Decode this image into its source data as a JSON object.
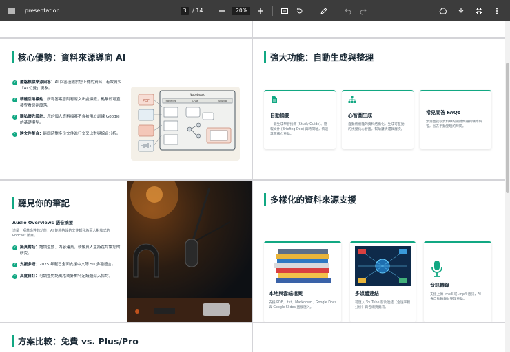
{
  "toolbar": {
    "title": "presentation",
    "page_current": "3",
    "page_total": "/ 14",
    "zoom": "20%"
  },
  "slides": {
    "s1": {
      "title": "核心優勢：資料來源導向 AI",
      "bullets": [
        {
          "label": "嚴格根據來源回答：",
          "text": "AI 回答僅限於您上傳的資料，有效減少「AI 幻覺」現象。"
        },
        {
          "label": "精確引用標註：",
          "text": "所有答案皆附有原文出處標籤，點擊即可直接查看原始段落。"
        },
        {
          "label": "隱私優先設計：",
          "text": "您的個人資料檔案不會被用於訓練 Google 的基礎模型。"
        },
        {
          "label": "跨文件整合：",
          "text": "能同時對多份文件進行交叉比對與綜合分析。"
        }
      ],
      "illustration": {
        "window_title": "Notebook",
        "tabs": [
          "Sources",
          "Chat",
          "Studio"
        ],
        "pdf_label": "PDF"
      }
    },
    "s2": {
      "title": "強大功能：自動生成與整理",
      "cards": [
        {
          "icon": "document-icon",
          "title": "自動摘要",
          "desc": "一鍵生成學習指南 (Study Guide)、簡報文件 (Briefing Doc) 與時間軸，快速掌握核心重點。"
        },
        {
          "icon": "sitemap-icon",
          "title": "心智圖生成",
          "desc": "自動將複雜的資料結構化，生成可互動的視覺化心智圖，幫助釐清邏輯層次。"
        },
        {
          "icon": "",
          "title": "常見問答 FAQs",
          "desc": "預測並提取資料中的關鍵問題與精準解答，省去手動整理的時間。"
        }
      ]
    },
    "s3": {
      "title": "聽見你的筆記",
      "subtitle": "Audio Overviews 語音摘要",
      "intro": "這是一項革命性的功能，AI 能將枯燥的文件轉化為兩人對談式的 Podcast 節目。",
      "bullets": [
        {
          "label": "擬真對話：",
          "text": "語調生動、內容連貫，就像真人主持在討論您的研究。"
        },
        {
          "label": "支援多語：",
          "text": "2025 年起已全面支援中文等 50 多種語言。"
        },
        {
          "label": "高度自訂：",
          "text": "可調整對話風格或針對特定議題深入探討。"
        }
      ]
    },
    "s4": {
      "title": "多樣化的資料來源支援",
      "cards": [
        {
          "icon": "books-image",
          "title": "本地與雲端檔案",
          "desc": "支援 PDF、.txt、Markdown、Google Docs 與 Google Slides 直接匯入。"
        },
        {
          "icon": "network-image",
          "title": "多媒體連結",
          "desc": "可匯入 YouTube 影片連結（含逐字稿分析）與各網頁資訊。"
        },
        {
          "icon": "microphone-icon",
          "title": "音訊轉錄",
          "desc": "支援上傳 .mp3 或 .mp4 音訊，AI 會自動轉錄並整理重點。"
        }
      ]
    },
    "s5": {
      "title": "方案比較：免費 vs. Plus/Pro"
    }
  },
  "colors": {
    "accent": "#12a883",
    "toolbar_bg": "#3c3c3c",
    "title_text": "#1b2a36"
  }
}
